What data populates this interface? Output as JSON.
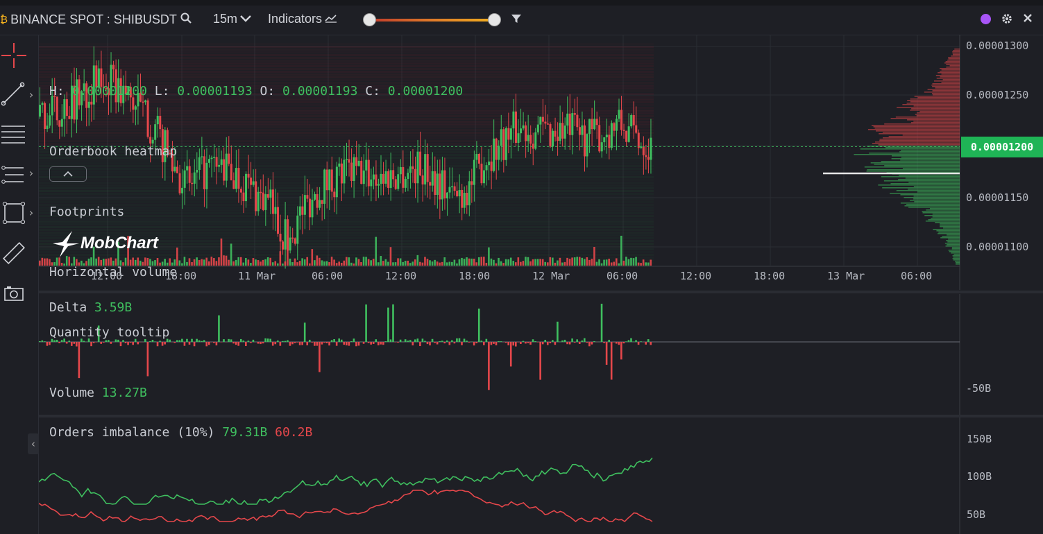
{
  "header": {
    "symbol": "BINANCE SPOT : SHIBUSDT",
    "timeframe": "15m",
    "indicators_label": "Indicators",
    "colors": {
      "accent_purple": "#a855f7",
      "up": "#3fbf5f",
      "down": "#e5474b"
    }
  },
  "main": {
    "ohlc": {
      "h_label": "H:",
      "h": "0.00001200",
      "l_label": "L:",
      "l": "0.00001193",
      "o_label": "O:",
      "o": "0.00001193",
      "c_label": "C:",
      "c": "0.00001200"
    },
    "layers": [
      "Orderbook heatmap",
      "Footprints",
      "Horizontal volume",
      "Quantity tooltip"
    ],
    "volume_label": "Volume",
    "volume_value": "13.27B",
    "watermark": "MobChart",
    "price_axis": [
      "0.00001300",
      "0.00001250",
      "0.00001150",
      "0.00001100"
    ],
    "current_price": "0.00001200",
    "time_axis": [
      "12:00",
      "18:00",
      "11 Mar",
      "06:00",
      "12:00",
      "18:00",
      "12 Mar",
      "06:00",
      "12:00",
      "18:00",
      "13 Mar",
      "06:00"
    ]
  },
  "delta": {
    "label": "Delta",
    "value": "3.59B",
    "axis": [
      "-50B"
    ]
  },
  "imbalance": {
    "label": "Orders imbalance (10%)",
    "buy": "79.31B",
    "sell": "60.2B",
    "axis": [
      "150B",
      "100B",
      "50B"
    ]
  },
  "chart_data": {
    "type": "line",
    "title": "",
    "series": [
      {
        "values": [
          1.23e-05,
          1.235e-05,
          1.245e-05,
          1.26e-05,
          1.265e-05,
          1.255e-05,
          1.24e-05,
          1.215e-05,
          1.185e-05,
          1.16e-05,
          1.175e-05,
          1.18e-05,
          1.17e-05,
          1.155e-05,
          1.14e-05,
          1.105e-05,
          1.14e-05,
          1.16e-05,
          1.17e-05,
          1.175e-05,
          1.172e-05,
          1.17e-05,
          1.175e-05,
          1.18e-05,
          1.17e-05,
          1.15e-05,
          1.16e-05,
          1.19e-05,
          1.205e-05,
          1.22e-05,
          1.217e-05,
          1.215e-05,
          1.218e-05,
          1.21e-05,
          1.212e-05,
          1.222e-05,
          1.212e-05,
          1.2e-05
        ]
      }
    ],
    "ylim": [
      1.08e-05,
      1.31e-05
    ]
  }
}
